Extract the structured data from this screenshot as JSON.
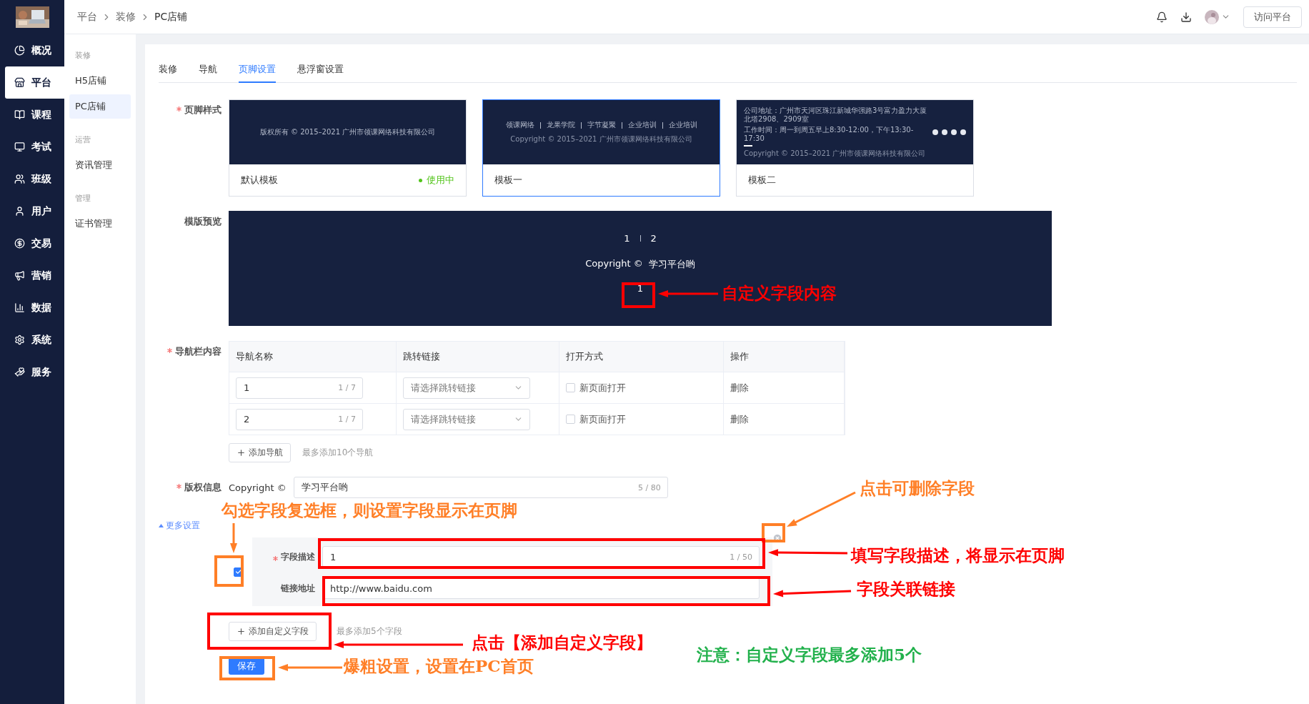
{
  "sidebar": {
    "items": [
      {
        "label": "概况",
        "selected": false
      },
      {
        "label": "平台",
        "selected": true
      },
      {
        "label": "课程",
        "selected": false
      },
      {
        "label": "考试",
        "selected": false
      },
      {
        "label": "班级",
        "selected": false
      },
      {
        "label": "用户",
        "selected": false
      },
      {
        "label": "交易",
        "selected": false
      },
      {
        "label": "营销",
        "selected": false
      },
      {
        "label": "数据",
        "selected": false
      },
      {
        "label": "系统",
        "selected": false
      },
      {
        "label": "服务",
        "selected": false
      }
    ]
  },
  "breadcrumb": [
    "平台",
    "装修",
    "PC店铺"
  ],
  "topbar": {
    "visit_button": "访问平台"
  },
  "submenu": {
    "groups": [
      {
        "title": "装修",
        "items": [
          {
            "label": "H5店铺",
            "selected": false
          },
          {
            "label": "PC店铺",
            "selected": true
          }
        ]
      },
      {
        "title": "运营",
        "items": [
          {
            "label": "资讯管理",
            "selected": false
          }
        ]
      },
      {
        "title": "管理",
        "items": [
          {
            "label": "证书管理",
            "selected": false
          }
        ]
      }
    ]
  },
  "tabs": [
    {
      "label": "装修",
      "selected": false
    },
    {
      "label": "导航",
      "selected": false
    },
    {
      "label": "页脚设置",
      "selected": true
    },
    {
      "label": "悬浮窗设置",
      "selected": false
    }
  ],
  "footer_style": {
    "label": "页脚样式",
    "required": true,
    "templates": [
      {
        "kind": "default",
        "name": "默认模板",
        "status": "使用中",
        "selected": false,
        "copyright": "版权所有 © 2015–2021 广州市领课网络科技有限公司"
      },
      {
        "kind": "nav",
        "name": "模板一",
        "selected": true,
        "nav": [
          "领课网络",
          "龙果学院",
          "字节凝聚",
          "企业培训",
          "企业培训"
        ],
        "copyright": "Copyright © 2015–2021 广州市领课网络科技有限公司"
      },
      {
        "kind": "contact",
        "name": "模板二",
        "selected": false,
        "lines": [
          {
            "label": "公司地址：",
            "value": "广州市天河区珠江新城华强路3号富力盈力大厦北塔2908、2909室"
          },
          {
            "label": "工作时间：",
            "value": "周一到周五早上8:30-12:00，下午13:30-17:30"
          }
        ],
        "copyright": "Copyright © 2015–2021 广州市领课网络科技有限公司"
      }
    ]
  },
  "template_preview": {
    "label": "模版预览",
    "nav": [
      "1",
      "2"
    ],
    "copyright_prefix": "Copyright ©",
    "copyright_text": "学习平台哟",
    "custom_field": "1"
  },
  "nav_content": {
    "label": "导航栏内容",
    "required": true,
    "columns": [
      "导航名称",
      "跳转链接",
      "打开方式",
      "操作"
    ],
    "rows": [
      {
        "name": "1",
        "count": "1 / 7",
        "link_placeholder": "请选择跳转链接",
        "open_label": "新页面打开",
        "checked": false,
        "action": "删除"
      },
      {
        "name": "2",
        "count": "1 / 7",
        "link_placeholder": "请选择跳转链接",
        "open_label": "新页面打开",
        "checked": false,
        "action": "删除"
      }
    ],
    "add_button": "添加导航",
    "hint": "最多添加10个导航"
  },
  "copyright": {
    "label": "版权信息",
    "required": true,
    "prefix": "Copyright ©",
    "value": "学习平台哟",
    "count": "5 / 80"
  },
  "more_settings": {
    "label": "更多设置",
    "expanded": true
  },
  "custom_fields": [
    {
      "checked": true,
      "description_label": "字段描述",
      "description": "1",
      "count": "1 / 50",
      "link_label": "链接地址",
      "link": "http://www.baidu.com"
    }
  ],
  "add_custom_button": "添加自定义字段",
  "custom_hint": "最多添加5个字段",
  "save_button": "保存",
  "annotations": [
    {
      "text": "自定义字段内容",
      "color": "#ff0000"
    },
    {
      "text": "点击可删除字段",
      "color": "#ff7f27"
    },
    {
      "text": "勾选字段复选框，则设置字段显示在页脚",
      "color": "#ff7f27"
    },
    {
      "text": "填写字段描述，将显示在页脚",
      "color": "#ff0000"
    },
    {
      "text": "字段关联链接",
      "color": "#ff0000"
    },
    {
      "text": "点击【添加自定义字段】",
      "color": "#ff0000"
    },
    {
      "text": "爆粗设置，设置在PC首页",
      "color": "#ff7f27"
    },
    {
      "text": "注意：自定义字段最多添加5个",
      "color": "#22b14c"
    }
  ]
}
